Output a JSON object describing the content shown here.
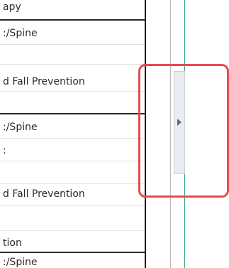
{
  "list": {
    "rows": [
      "apy",
      ":/Spine",
      "d Fall Prevention",
      ":/Spine",
      ":",
      "d Fall Prevention",
      "tion",
      ":/Spine"
    ]
  },
  "colors": {
    "highlight": "#e84a52",
    "splitter_green": "#2ea37a",
    "splitter_gray": "#b8b8b8"
  },
  "icons": {
    "expand": "caret-right-icon"
  }
}
